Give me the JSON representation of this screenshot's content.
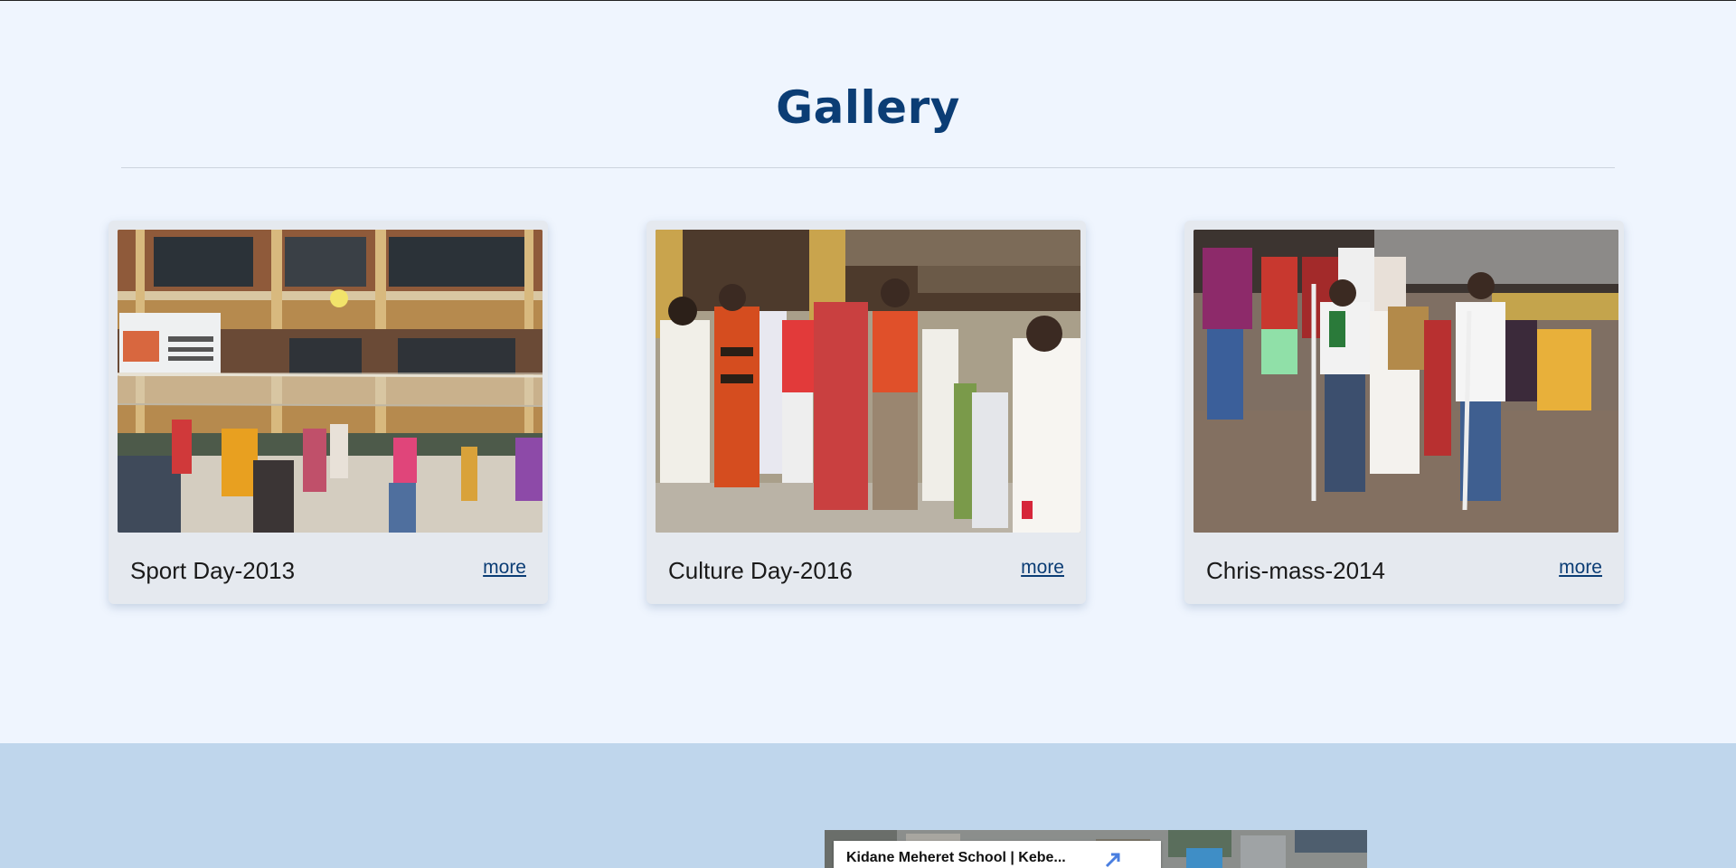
{
  "gallery": {
    "title": "Gallery",
    "cards": [
      {
        "caption": "Sport Day-2013",
        "more_label": "more"
      },
      {
        "caption": "Culture Day-2016",
        "more_label": "more"
      },
      {
        "caption": "Chris-mass-2014",
        "more_label": "more"
      }
    ]
  },
  "footer": {
    "map": {
      "place_title": "Kidane Meheret School | Kebe...",
      "icon": "expand-map-icon"
    }
  },
  "colors": {
    "page_bg": "#eff5fe",
    "title": "#0b3d75",
    "card_bg": "#e5e9ef",
    "link": "#0b3d75",
    "footer_bg": "#bfd6ec"
  }
}
